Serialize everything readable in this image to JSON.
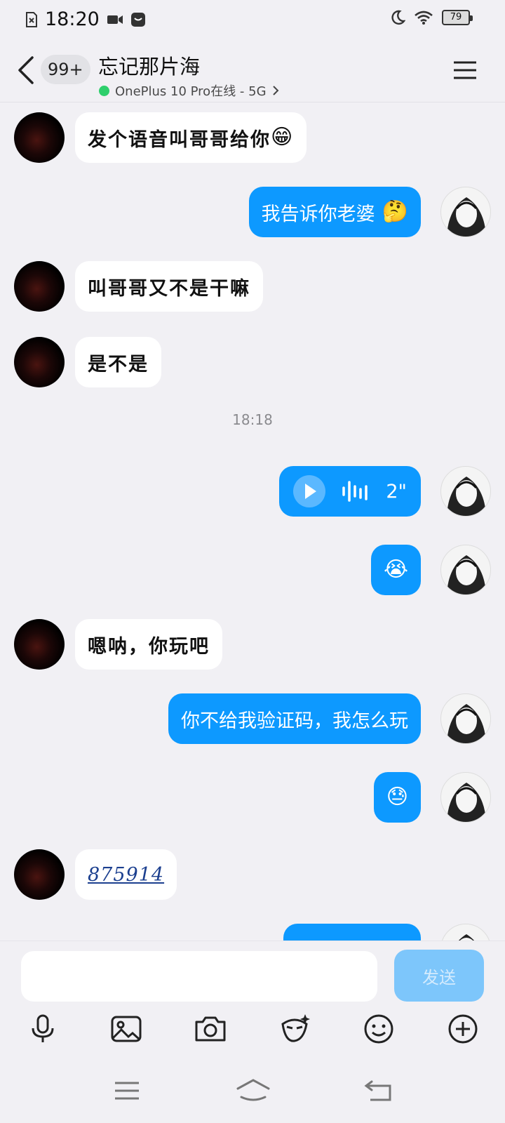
{
  "status_bar": {
    "time": "18:20",
    "battery": "79"
  },
  "header": {
    "unread_badge": "99+",
    "title": "忘记那片海",
    "device_status": "OnePlus 10 Pro在线 - 5G"
  },
  "messages": [
    {
      "from": "them",
      "text": "发个语音叫哥哥给你",
      "emoji": "😁"
    },
    {
      "from": "me",
      "text": "我告诉你老婆",
      "emoji": "🤔"
    },
    {
      "from": "them",
      "text": "叫哥哥又不是干嘛"
    },
    {
      "from": "them",
      "text": "是不是"
    },
    {
      "timestamp": "18:18"
    },
    {
      "from": "me",
      "type": "voice",
      "duration": "2\""
    },
    {
      "from": "me",
      "emoji": "😭"
    },
    {
      "from": "them",
      "text": "嗯呐，你玩吧"
    },
    {
      "from": "me",
      "text": "你不给我验证码，我怎么玩"
    },
    {
      "from": "me",
      "emoji": "😓"
    },
    {
      "from": "them",
      "text": "875914",
      "style": "code"
    }
  ],
  "composer": {
    "placeholder": "",
    "send_label": "发送"
  },
  "toolbar_icons": [
    "microphone-icon",
    "image-icon",
    "camera-icon",
    "sticker-icon",
    "emoji-icon",
    "plus-icon"
  ],
  "colors": {
    "accent": "#0d99ff",
    "send_disabled": "#7dc6fb",
    "online": "#2ecf6c",
    "background": "#f1f0f4"
  }
}
